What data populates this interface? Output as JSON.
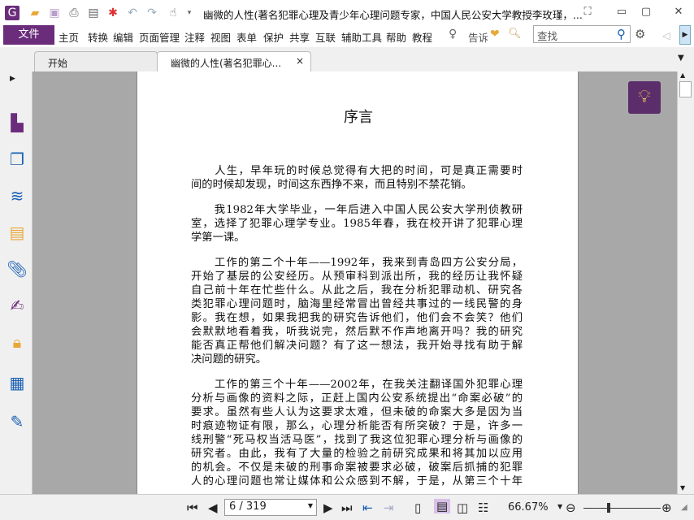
{
  "app": {
    "title": "幽微的人性(著名犯罪心理及青少年心理问题专家，中国人民公安大学教授李玫瑾，...",
    "accent": "#6b2d7b"
  },
  "quick_access": [
    "app-logo-icon",
    "open-icon",
    "save-icon",
    "print-icon",
    "properties-icon",
    "new-icon",
    "undo-icon",
    "redo-icon",
    "hand-tool-icon"
  ],
  "menu": {
    "file": "文件",
    "items": [
      "主页",
      "转换",
      "编辑",
      "页面管理",
      "注释",
      "视图",
      "表单",
      "保护",
      "共享",
      "互联",
      "辅助工具",
      "帮助",
      "教程"
    ],
    "tell_me": "告诉",
    "search_placeholder": "查找"
  },
  "tabs": [
    {
      "label": "开始"
    },
    {
      "label": "幽微的人性(著名犯罪心...",
      "close": "×"
    }
  ],
  "document": {
    "heading": "序言",
    "paragraphs": [
      [
        "　　人生，早年玩的时候总觉得有大把的时间，可是真正需要时",
        "间的时候却发现，时间这东西挣不来，而且特别不禁花销。"
      ],
      [
        "　　我1982年大学毕业，一年后进入中国人民公安大学刑侦教研",
        "室，选择了犯罪心理学专业。1985年春，我在校开讲了犯罪心理",
        "学第一课。"
      ],
      [
        "　　工作的第二个十年——1992年，我来到青岛四方公安分局，",
        "开始了基层的公安经历。从预审科到派出所，我的经历让我怀疑",
        "自己前十年在忙些什么。从此之后，我在分析犯罪动机、研究各",
        "类犯罪心理问题时，脑海里经常冒出曾经共事过的一线民警的身",
        "影。我在想，如果我把我的研究告诉他们，他们会不会笑？他们",
        "会默默地看着我，听我说完，然后默不作声地离开吗？我的研究",
        "能否真正帮他们解决问题？有了这一想法，我开始寻找有助于解",
        "决问题的研究。"
      ],
      [
        "　　工作的第三个十年——2002年，在我关注翻译国外犯罪心理",
        "分析与画像的资料之际，正赶上国内公安系统提出“命案必破”的",
        "要求。虽然有些人认为这要求太难，但未破的命案大多是因为当",
        "时痕迹物证有限，那么，心理分析能否有所突破？于是，许多一",
        "线刑警“死马权当活马医”，找到了我这位犯罪心理分析与画像的",
        "研究者。由此，我有了大量的检验之前研究成果和将其加以应用",
        "的机会。不仅是未破的刑事命案被要求必破，破案后抓捕的犯罪",
        "人的心理问题也常让媒体和公众感到不解，于是，从第三个十年"
      ]
    ]
  },
  "status": {
    "page": "6 / 319",
    "zoom": "66.67%",
    "zoom_level_percent": 66.67
  }
}
